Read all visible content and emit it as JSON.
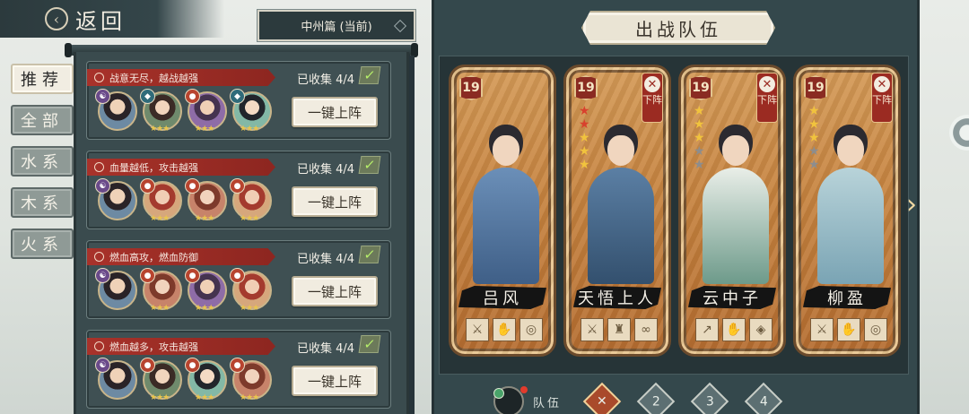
{
  "header": {
    "back_label": "返回",
    "chapter_label": "中州篇 (当前)"
  },
  "tabs": [
    {
      "label": "推荐",
      "active": true
    },
    {
      "label": "全部",
      "active": false
    },
    {
      "label": "水系",
      "active": false
    },
    {
      "label": "木系",
      "active": false
    },
    {
      "label": "火系",
      "active": false
    }
  ],
  "lineups": [
    {
      "banner": "战意无尽，越战越强",
      "collected": "已收集 4/4",
      "button": "一键上阵"
    },
    {
      "banner": "血量越低，攻击越强",
      "collected": "已收集 4/4",
      "button": "一键上阵"
    },
    {
      "banner": "燃血高攻，燃血防御",
      "collected": "已收集 4/4",
      "button": "一键上阵"
    },
    {
      "banner": "燃血越多，攻击越强",
      "collected": "已收集 4/4",
      "button": "一键上阵"
    }
  ],
  "team": {
    "title": "出战队伍",
    "remove_label": "下阵",
    "heroes": [
      {
        "name": "吕风",
        "level": "19",
        "stars": [],
        "removable": false
      },
      {
        "name": "天悟上人",
        "level": "19",
        "stars": [
          "red",
          "red",
          "gold",
          "gold",
          "gold"
        ],
        "removable": true
      },
      {
        "name": "云中子",
        "level": "19",
        "stars": [
          "gold",
          "gold",
          "gold",
          "grey",
          "grey"
        ],
        "removable": true
      },
      {
        "name": "柳盈",
        "level": "19",
        "stars": [
          "gold",
          "gold",
          "gold",
          "grey",
          "grey"
        ],
        "removable": true
      }
    ]
  },
  "team_bar": {
    "label": "队伍",
    "tabs": [
      "2",
      "3",
      "4"
    ]
  },
  "colors": {
    "accent_red": "#a8322a",
    "panel": "#3a4b4e",
    "card_gold": "#c6833f"
  }
}
